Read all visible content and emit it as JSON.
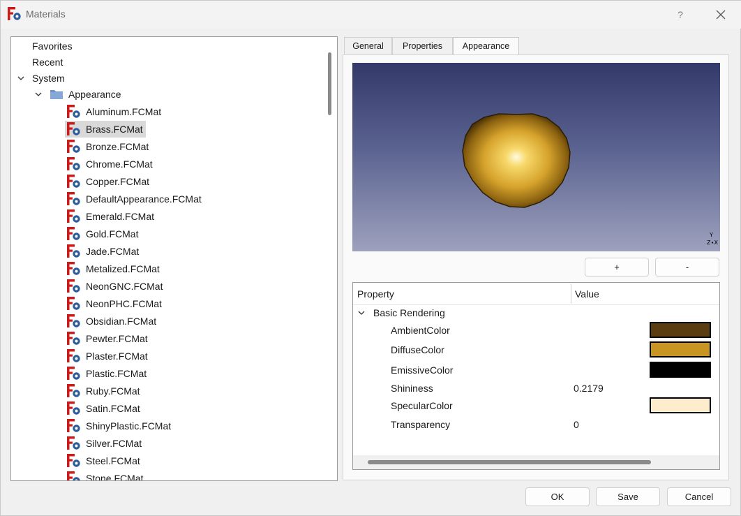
{
  "window": {
    "title": "Materials",
    "help_label": "?"
  },
  "tree": {
    "favorites": "Favorites",
    "recent": "Recent",
    "system": "System",
    "appearance_folder": "Appearance",
    "materials": [
      "Aluminum.FCMat",
      "Brass.FCMat",
      "Bronze.FCMat",
      "Chrome.FCMat",
      "Copper.FCMat",
      "DefaultAppearance.FCMat",
      "Emerald.FCMat",
      "Gold.FCMat",
      "Jade.FCMat",
      "Metalized.FCMat",
      "NeonGNC.FCMat",
      "NeonPHC.FCMat",
      "Obsidian.FCMat",
      "Pewter.FCMat",
      "Plaster.FCMat",
      "Plastic.FCMat",
      "Ruby.FCMat",
      "Satin.FCMat",
      "ShinyPlastic.FCMat",
      "Silver.FCMat",
      "Steel.FCMat",
      "Stone.FCMat"
    ],
    "selected": "Brass.FCMat"
  },
  "tabs": [
    "General",
    "Properties",
    "Appearance"
  ],
  "active_tab": "Appearance",
  "viewer": {
    "axis_y": "Y",
    "axis_zx": "Z∙X"
  },
  "buttons": {
    "add": "+",
    "remove": "-"
  },
  "properties": {
    "header_property": "Property",
    "header_value": "Value",
    "group": "Basic Rendering",
    "rows": [
      {
        "name": "AmbientColor",
        "color": "#5a3d10"
      },
      {
        "name": "DiffuseColor",
        "color": "#c89523"
      },
      {
        "name": "EmissiveColor",
        "color": "#000000"
      },
      {
        "name": "Shininess",
        "value": "0.2179"
      },
      {
        "name": "SpecularColor",
        "color": "#fdedcc"
      },
      {
        "name": "Transparency",
        "value": "0"
      }
    ]
  },
  "footer": {
    "ok": "OK",
    "save": "Save",
    "cancel": "Cancel"
  }
}
